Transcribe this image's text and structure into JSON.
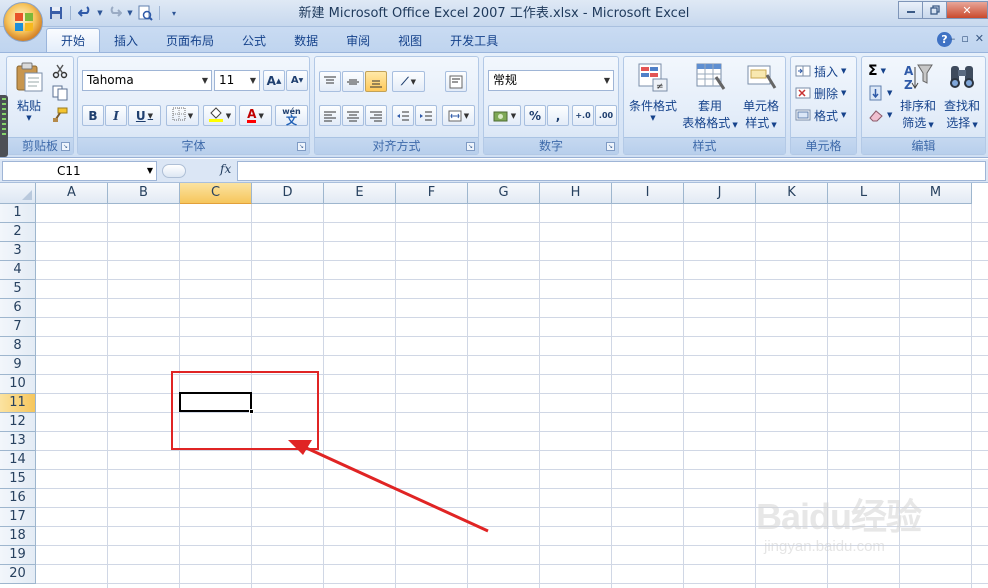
{
  "window": {
    "title": "新建 Microsoft Office Excel 2007 工作表.xlsx - Microsoft Excel",
    "controls": [
      "minimize",
      "restore",
      "close"
    ]
  },
  "qat": {
    "icons": [
      "save-icon",
      "undo-icon",
      "redo-icon",
      "print-preview-icon",
      "customize-icon"
    ]
  },
  "tabs": [
    {
      "label": "开始",
      "active": true
    },
    {
      "label": "插入"
    },
    {
      "label": "页面布局"
    },
    {
      "label": "公式"
    },
    {
      "label": "数据"
    },
    {
      "label": "审阅"
    },
    {
      "label": "视图"
    },
    {
      "label": "开发工具"
    }
  ],
  "ribbon": {
    "clipboard": {
      "group_label": "剪贴板",
      "paste_label": "粘贴"
    },
    "font": {
      "group_label": "字体",
      "font_name": "Tahoma",
      "font_size": "11",
      "phonetic": "wén",
      "phonetic_char": "文"
    },
    "alignment": {
      "group_label": "对齐方式"
    },
    "number": {
      "group_label": "数字",
      "format": "常规"
    },
    "styles": {
      "group_label": "样式",
      "conditional_l1": "条件格式",
      "table_l1": "套用",
      "table_l2": "表格格式",
      "cell_l1": "单元格",
      "cell_l2": "样式"
    },
    "cells": {
      "group_label": "单元格",
      "insert": "插入",
      "delete": "删除",
      "format": "格式"
    },
    "editing": {
      "group_label": "编辑",
      "sort_l1": "排序和",
      "sort_l2": "筛选",
      "find_l1": "查找和",
      "find_l2": "选择"
    }
  },
  "formula_bar": {
    "name_box": "C11",
    "fx": "fx",
    "content": ""
  },
  "sheet": {
    "columns": [
      "A",
      "B",
      "C",
      "D",
      "E",
      "F",
      "G",
      "H",
      "I",
      "J",
      "K",
      "L",
      "M"
    ],
    "rows": [
      "1",
      "2",
      "3",
      "4",
      "5",
      "6",
      "7",
      "8",
      "9",
      "10",
      "11",
      "12",
      "13",
      "14",
      "15",
      "16",
      "17",
      "18",
      "19",
      "20"
    ],
    "selected_column": "C",
    "selected_row": "11",
    "active_cell": "C11"
  },
  "annotation": {
    "color": "#e02424"
  },
  "watermark": {
    "main": "Baidu经验",
    "sub": "jingyan.baidu.com"
  },
  "colors": {
    "selection_header": "#f6c65c",
    "ribbon_bg": "#dbe7f7",
    "grid_line": "#d0d7e5"
  }
}
